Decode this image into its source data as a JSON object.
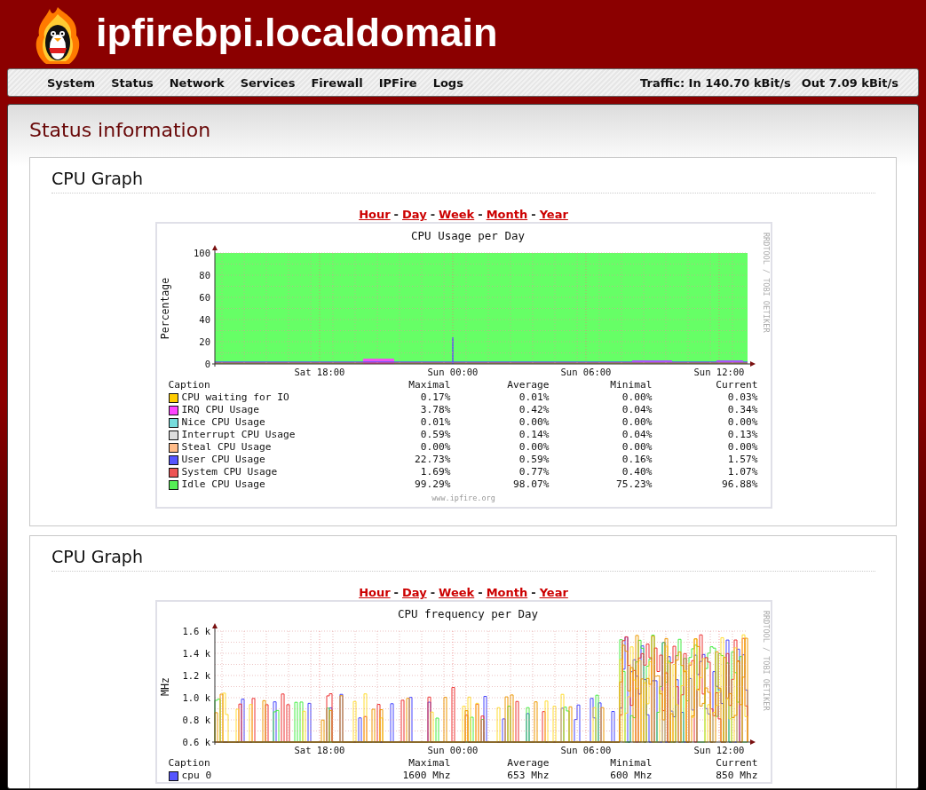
{
  "header": {
    "hostname": "ipfirebpi.localdomain"
  },
  "nav": {
    "items": [
      {
        "label": "System"
      },
      {
        "label": "Status"
      },
      {
        "label": "Network"
      },
      {
        "label": "Services"
      },
      {
        "label": "Firewall"
      },
      {
        "label": "IPFire"
      },
      {
        "label": "Logs"
      }
    ],
    "traffic_in": "Traffic: In 140.70 kBit/s",
    "traffic_out": "Out 7.09 kBit/s"
  },
  "page_title": "Status information",
  "sections": [
    {
      "title": "CPU Graph",
      "separator": "-",
      "periods": [
        {
          "label": "Hour"
        },
        {
          "label": "Day"
        },
        {
          "label": "Week"
        },
        {
          "label": "Month"
        },
        {
          "label": "Year"
        }
      ],
      "graph": {
        "kind": "usage",
        "title": "CPU Usage per Day",
        "ylabel": "Percentage",
        "yticks": [
          "100",
          "80",
          "60",
          "40",
          "20",
          "0"
        ],
        "xticks": [
          "Sat 18:00",
          "Sun 00:00",
          "Sun 06:00",
          "Sun 12:00"
        ],
        "credit": "RRDTOOL / TOBI OETIKER",
        "legend": {
          "columns": [
            "Caption",
            "Maximal",
            "Average",
            "Minimal",
            "Current"
          ],
          "rows": [
            {
              "caption": "CPU waiting for IO",
              "color": "#ffcc00",
              "values": [
                "0.17%",
                "0.01%",
                "0.00%",
                "0.03%"
              ]
            },
            {
              "caption": "IRQ CPU Usage",
              "color": "#ff44ff",
              "values": [
                "3.78%",
                "0.42%",
                "0.04%",
                "0.34%"
              ]
            },
            {
              "caption": "Nice CPU Usage",
              "color": "#77dddd",
              "values": [
                "0.01%",
                "0.00%",
                "0.00%",
                "0.00%"
              ]
            },
            {
              "caption": "Interrupt CPU Usage",
              "color": "#dddddd",
              "values": [
                "0.59%",
                "0.14%",
                "0.04%",
                "0.13%"
              ]
            },
            {
              "caption": "Steal CPU Usage",
              "color": "#ffbb88",
              "values": [
                "0.00%",
                "0.00%",
                "0.00%",
                "0.00%"
              ]
            },
            {
              "caption": "User CPU Usage",
              "color": "#5555ff",
              "values": [
                "22.73%",
                "0.59%",
                "0.16%",
                "1.57%"
              ]
            },
            {
              "caption": "System CPU Usage",
              "color": "#ee5555",
              "values": [
                "1.69%",
                "0.77%",
                "0.40%",
                "1.07%"
              ]
            },
            {
              "caption": "Idle CPU Usage",
              "color": "#55ee55",
              "values": [
                "99.29%",
                "98.07%",
                "75.23%",
                "96.88%"
              ]
            }
          ]
        },
        "footer": "www.ipfire.org"
      }
    },
    {
      "title": "CPU Graph",
      "separator": "-",
      "periods": [
        {
          "label": "Hour"
        },
        {
          "label": "Day"
        },
        {
          "label": "Week"
        },
        {
          "label": "Month"
        },
        {
          "label": "Year"
        }
      ],
      "graph": {
        "kind": "frequency",
        "title": "CPU frequency per Day",
        "ylabel": "MHz",
        "yticks": [
          "1.6 k",
          "1.4 k",
          "1.2 k",
          "1.0 k",
          "0.8 k",
          "0.6 k"
        ],
        "xticks": [
          "Sat 18:00",
          "Sun 00:00",
          "Sun 06:00",
          "Sun 12:00"
        ],
        "credit": "RRDTOOL / TOBI OETIKER",
        "legend": {
          "columns": [
            "Caption",
            "Maximal",
            "Average",
            "Minimal",
            "Current"
          ],
          "rows": [
            {
              "caption": "cpu 0",
              "color": "#5555ff",
              "values": [
                "1600 Mhz",
                "653 Mhz",
                "600 Mhz",
                "850 Mhz"
              ]
            }
          ]
        }
      }
    }
  ]
}
